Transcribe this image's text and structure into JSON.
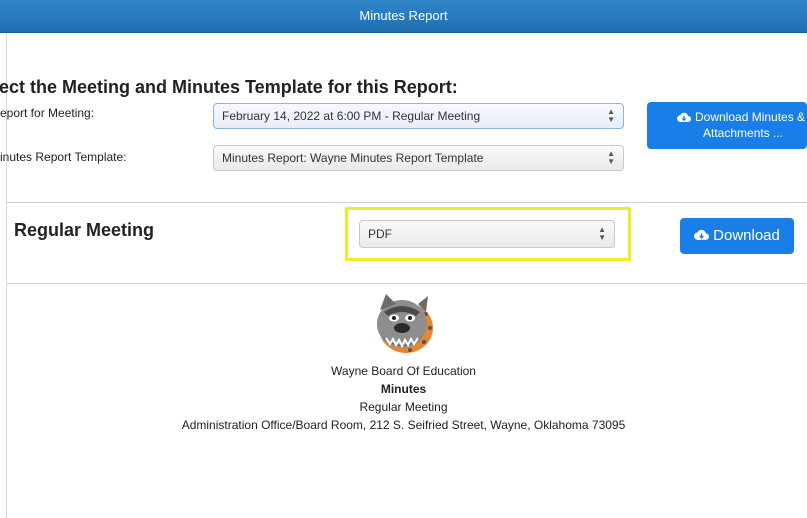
{
  "window": {
    "title": "Minutes Report"
  },
  "form": {
    "heading": "lect the Meeting and Minutes Template for this Report:",
    "meeting_label": "eport for Meeting:",
    "meeting_value": "February 14, 2022 at 6:00 PM - Regular Meeting",
    "template_label": "inutes Report Template:",
    "template_value": "Minutes Report: Wayne Minutes Report Template",
    "download_attachments_label_line1": "Download Minutes &",
    "download_attachments_label_line2": "Attachments ..."
  },
  "report": {
    "meeting_title": "Regular Meeting",
    "format_value": "PDF",
    "download_label": "Download"
  },
  "preview": {
    "organization": "Wayne Board Of Education",
    "doc_title": "Minutes",
    "meeting_type": "Regular Meeting",
    "address": "Administration Office/Board Room, 212 S. Seifried Street, Wayne, Oklahoma 73095"
  },
  "colors": {
    "titlebar": "#1f6fb0",
    "button": "#1a7ee8",
    "highlight": "#ecec2a"
  },
  "icons": [
    "cloud-download-icon",
    "select-caret-icon",
    "bulldog-logo"
  ]
}
